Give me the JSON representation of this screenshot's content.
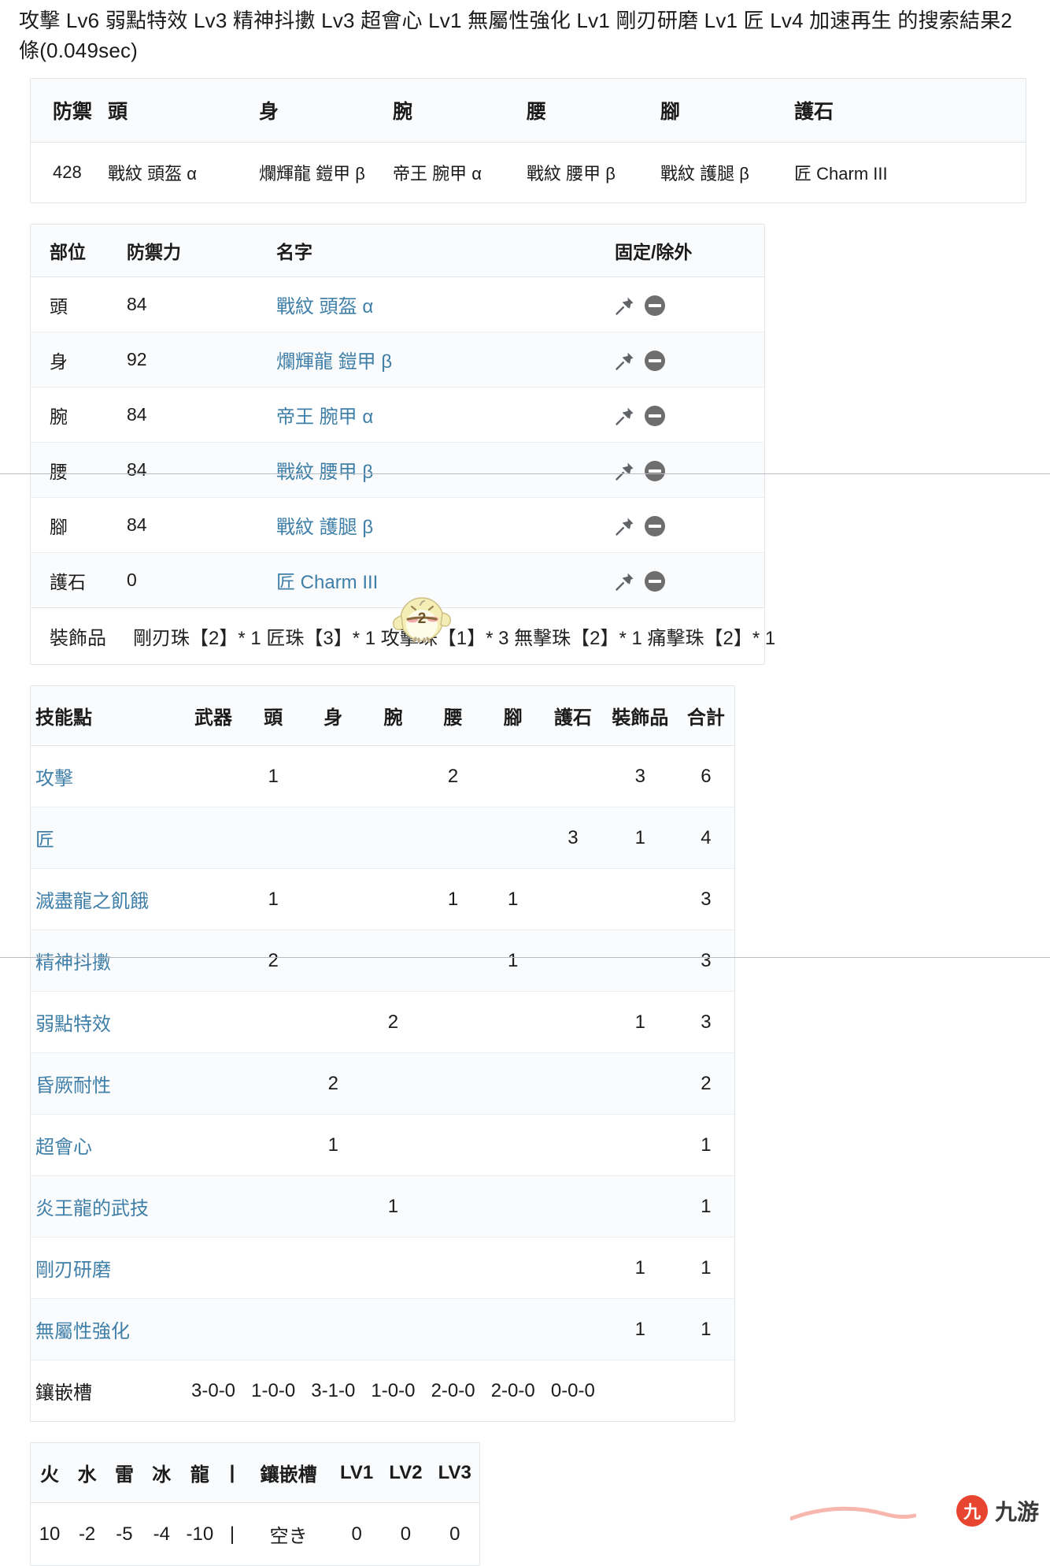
{
  "search": {
    "headline": "攻擊 Lv6 弱點特效 Lv3 精神抖擻 Lv3 超會心 Lv1 無屬性強化 Lv1 剛刃研磨 Lv1 匠 Lv4 加速再生 的搜索結果2條(0.049sec)"
  },
  "summary": {
    "headers": [
      "防禦",
      "頭",
      "身",
      "腕",
      "腰",
      "腳",
      "護石"
    ],
    "row": [
      "428",
      "戰紋 頭盔 α",
      "爛輝龍 鎧甲 β",
      "帝王 腕甲 α",
      "戰紋 腰甲 β",
      "戰紋 護腿 β",
      "匠 Charm III"
    ]
  },
  "pieces": {
    "headers": [
      "部位",
      "防禦力",
      "名字",
      "固定/除外"
    ],
    "rows": [
      {
        "part": "頭",
        "defense": "84",
        "name": "戰紋 頭盔 α"
      },
      {
        "part": "身",
        "defense": "92",
        "name": "爛輝龍 鎧甲 β"
      },
      {
        "part": "腕",
        "defense": "84",
        "name": "帝王 腕甲 α"
      },
      {
        "part": "腰",
        "defense": "84",
        "name": "戰紋 腰甲 β"
      },
      {
        "part": "腳",
        "defense": "84",
        "name": "戰紋 護腿 β"
      },
      {
        "part": "護石",
        "defense": "0",
        "name": "匠 Charm III"
      }
    ],
    "icons": {
      "pin": "pin-icon",
      "exclude": "minus-circle-icon"
    }
  },
  "decorations": {
    "label": "裝飾品",
    "value": "剛刃珠【2】* 1 匠珠【3】* 1 攻擊珠【1】* 3 無擊珠【2】* 1 痛擊珠【2】* 1"
  },
  "skills": {
    "headers": [
      "技能點",
      "武器",
      "頭",
      "身",
      "腕",
      "腰",
      "腳",
      "護石",
      "裝飾品",
      "合計"
    ],
    "rows": [
      {
        "name": "攻擊",
        "weapon": "",
        "head": "1",
        "body": "",
        "arms": "",
        "waist": "2",
        "legs": "",
        "charm": "",
        "deco": "3",
        "total": "6"
      },
      {
        "name": "匠",
        "weapon": "",
        "head": "",
        "body": "",
        "arms": "",
        "waist": "",
        "legs": "",
        "charm": "3",
        "deco": "1",
        "total": "4"
      },
      {
        "name": "滅盡龍之飢餓",
        "weapon": "",
        "head": "1",
        "body": "",
        "arms": "",
        "waist": "1",
        "legs": "1",
        "charm": "",
        "deco": "",
        "total": "3"
      },
      {
        "name": "精神抖擻",
        "weapon": "",
        "head": "2",
        "body": "",
        "arms": "",
        "waist": "",
        "legs": "1",
        "charm": "",
        "deco": "",
        "total": "3"
      },
      {
        "name": "弱點特效",
        "weapon": "",
        "head": "",
        "body": "",
        "arms": "2",
        "waist": "",
        "legs": "",
        "charm": "",
        "deco": "1",
        "total": "3"
      },
      {
        "name": "昏厥耐性",
        "weapon": "",
        "head": "",
        "body": "2",
        "arms": "",
        "waist": "",
        "legs": "",
        "charm": "",
        "deco": "",
        "total": "2"
      },
      {
        "name": "超會心",
        "weapon": "",
        "head": "",
        "body": "1",
        "arms": "",
        "waist": "",
        "legs": "",
        "charm": "",
        "deco": "",
        "total": "1"
      },
      {
        "name": "炎王龍的武技",
        "weapon": "",
        "head": "",
        "body": "",
        "arms": "1",
        "waist": "",
        "legs": "",
        "charm": "",
        "deco": "",
        "total": "1"
      },
      {
        "name": "剛刃研磨",
        "weapon": "",
        "head": "",
        "body": "",
        "arms": "",
        "waist": "",
        "legs": "",
        "charm": "",
        "deco": "1",
        "total": "1"
      },
      {
        "name": "無屬性強化",
        "weapon": "",
        "head": "",
        "body": "",
        "arms": "",
        "waist": "",
        "legs": "",
        "charm": "",
        "deco": "1",
        "total": "1"
      }
    ],
    "slots_label": "鑲嵌槽",
    "slots": [
      "3-0-0",
      "1-0-0",
      "3-1-0",
      "1-0-0",
      "2-0-0",
      "2-0-0",
      "0-0-0"
    ]
  },
  "resistance": {
    "headers": [
      "火",
      "水",
      "雷",
      "冰",
      "龍",
      "|",
      "鑲嵌槽",
      "LV1",
      "LV2",
      "LV3"
    ],
    "values": [
      "10",
      "-2",
      "-5",
      "-4",
      "-10",
      "|",
      "空き",
      "0",
      "0",
      "0"
    ]
  },
  "watermark": {
    "badge": "九",
    "text": "九游"
  },
  "colors": {
    "link": "#3f7fa8",
    "border": "#e3e6e8",
    "row_alt": "#fafbfc",
    "watermark_red": "#e8402a"
  }
}
